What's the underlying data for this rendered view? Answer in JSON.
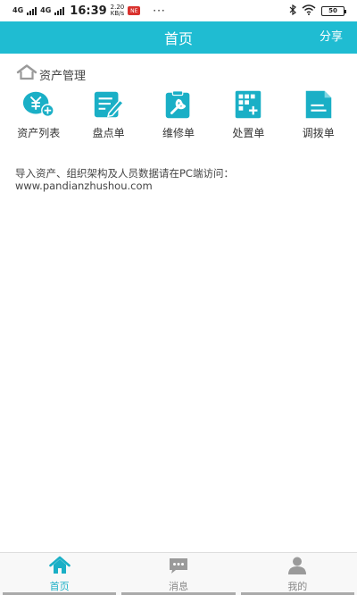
{
  "status_bar": {
    "net1": "4G",
    "net2": "4G",
    "time": "16:39",
    "speed_value": "2.20",
    "speed_unit": "KB/s",
    "app_badge": "NE",
    "more": "···",
    "battery": "50"
  },
  "header": {
    "title": "首页",
    "share_label": "分享"
  },
  "section": {
    "title": "资产管理",
    "icon": "home-outline-icon"
  },
  "grid": [
    {
      "label": "资产列表",
      "icon": "yen-add-icon"
    },
    {
      "label": "盘点单",
      "icon": "notepad-pen-icon"
    },
    {
      "label": "维修单",
      "icon": "wrench-clipboard-icon"
    },
    {
      "label": "处置单",
      "icon": "grid-plus-icon"
    },
    {
      "label": "调拨单",
      "icon": "document-icon"
    }
  ],
  "notice": {
    "line1": "导入资产、组织架构及人员数据请在PC端访问：",
    "line2": "www.pandianzhushou.com"
  },
  "tabbar": {
    "tabs": [
      {
        "label": "首页",
        "icon": "home-icon",
        "active": true
      },
      {
        "label": "消息",
        "icon": "chat-bubble-icon",
        "active": false
      },
      {
        "label": "我的",
        "icon": "person-icon",
        "active": false
      }
    ]
  },
  "colors": {
    "primary": "#1fbcd2",
    "icon_teal": "#1aafc6",
    "inactive": "#9a9a9a"
  }
}
